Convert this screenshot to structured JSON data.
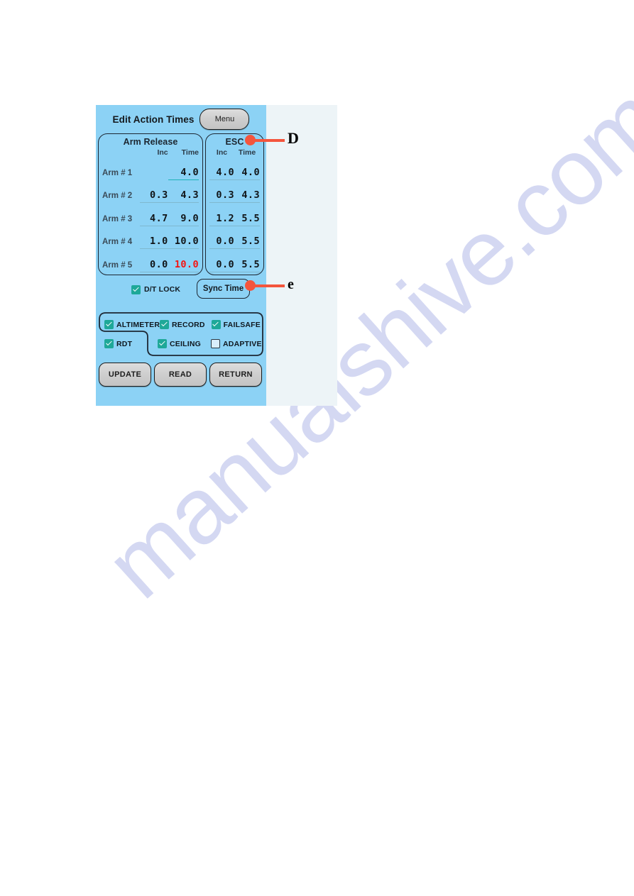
{
  "watermark": {
    "text": "manualshive.com"
  },
  "colors": {
    "screen_background": "#8CD2F5",
    "page_background": "#EDF4F7",
    "checkbox_on": "#1EA898",
    "alert_value": "#F5120F",
    "focus_underline": "#1FB2B8",
    "callout": "#F4553D",
    "button_face": "#CFCFCF"
  },
  "header": {
    "title": "Edit Action Times",
    "menu_label": "Menu"
  },
  "tables": {
    "arm_release": {
      "title": "Arm Release",
      "columns": [
        "",
        "Inc",
        "Time"
      ],
      "rows": [
        {
          "label": "Arm # 1",
          "inc": "",
          "time": "4.0",
          "inc_blank": true,
          "time_alert": false,
          "time_focus": true
        },
        {
          "label": "Arm # 2",
          "inc": "0.3",
          "time": "4.3",
          "inc_blank": false,
          "time_alert": false,
          "time_focus": false
        },
        {
          "label": "Arm # 3",
          "inc": "4.7",
          "time": "9.0",
          "inc_blank": false,
          "time_alert": false,
          "time_focus": false
        },
        {
          "label": "Arm # 4",
          "inc": "1.0",
          "time": "10.0",
          "inc_blank": false,
          "time_alert": false,
          "time_focus": false
        },
        {
          "label": "Arm # 5",
          "inc": "0.0",
          "time": "10.0",
          "inc_blank": false,
          "time_alert": true,
          "time_focus": false
        }
      ]
    },
    "esc": {
      "title": "ESC",
      "columns": [
        "Inc",
        "Time"
      ],
      "rows": [
        {
          "inc": "4.0",
          "time": "4.0"
        },
        {
          "inc": "0.3",
          "time": "4.3"
        },
        {
          "inc": "1.2",
          "time": "5.5"
        },
        {
          "inc": "0.0",
          "time": "5.5"
        },
        {
          "inc": "0.0",
          "time": "5.5"
        }
      ]
    }
  },
  "mid_row": {
    "dt_lock": {
      "label": "D/T LOCK",
      "checked": true
    },
    "sync_time_label": "Sync Time"
  },
  "options": {
    "row1": [
      {
        "label": "ALTIMETER",
        "checked": true
      },
      {
        "label": "RECORD",
        "checked": true
      },
      {
        "label": "FAILSAFE",
        "checked": true
      }
    ],
    "row2": [
      {
        "label": "RDT",
        "checked": true
      },
      {
        "label": "CEILING",
        "checked": true
      },
      {
        "label": "ADAPTIVE",
        "checked": false
      }
    ]
  },
  "bottom_buttons": [
    {
      "label": "UPDATE"
    },
    {
      "label": "READ"
    },
    {
      "label": "RETURN"
    }
  ],
  "callouts": [
    {
      "letter": "D",
      "points_at": "ESC panel title"
    },
    {
      "letter": "e",
      "points_at": "Sync Time button"
    }
  ]
}
